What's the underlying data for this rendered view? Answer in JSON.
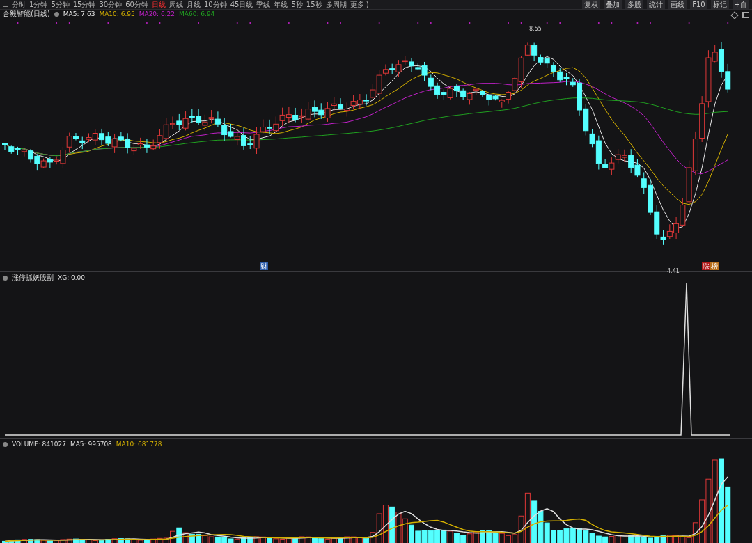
{
  "toolbar": {
    "periods": [
      {
        "label": "分时",
        "selected": false
      },
      {
        "label": "1分钟",
        "selected": false
      },
      {
        "label": "5分钟",
        "selected": false
      },
      {
        "label": "15分钟",
        "selected": false
      },
      {
        "label": "30分钟",
        "selected": false
      },
      {
        "label": "60分钟",
        "selected": false
      },
      {
        "label": "日线",
        "selected": true
      },
      {
        "label": "周线",
        "selected": false
      },
      {
        "label": "月线",
        "selected": false
      },
      {
        "label": "10分钟",
        "selected": false
      },
      {
        "label": "45日线",
        "selected": false
      },
      {
        "label": "季线",
        "selected": false
      },
      {
        "label": "年线",
        "selected": false
      },
      {
        "label": "5秒",
        "selected": false
      },
      {
        "label": "15秒",
        "selected": false
      },
      {
        "label": "多周期",
        "selected": false
      },
      {
        "label": "更多 )",
        "selected": false
      }
    ],
    "tools": [
      "复权",
      "叠加",
      "多股",
      "统计",
      "画线",
      "F10",
      "标记",
      "+自"
    ]
  },
  "price_pane": {
    "title": "合毅智能(日线)",
    "indicators": [
      {
        "label": "MA5: 7.63",
        "color": "#e6e6e6"
      },
      {
        "label": "MA10: 6.95",
        "color": "#d4b000"
      },
      {
        "label": "MA20: 6.22",
        "color": "#c020c8"
      },
      {
        "label": "MA60: 6.94",
        "color": "#20a020"
      }
    ],
    "high_label": "8.55",
    "low_label": "4.41",
    "event_marks": [
      {
        "text": "财",
        "color": "#2a5aa8"
      },
      {
        "text": "涨",
        "color": "#b01818"
      },
      {
        "text": "榜",
        "color": "#b8701c"
      }
    ]
  },
  "indicator_pane": {
    "title": "涨停抓妖股副",
    "indicators": [
      {
        "label": "XG: 0.00",
        "color": "#e0e0e0"
      }
    ]
  },
  "volume_pane": {
    "indicators": [
      {
        "label": "VOLUME: 841027"
      },
      {
        "label": "MA5: 995708",
        "color": "#e0e0e0"
      },
      {
        "label": "MA10: 681778",
        "color": "#d4b000"
      }
    ]
  }
}
